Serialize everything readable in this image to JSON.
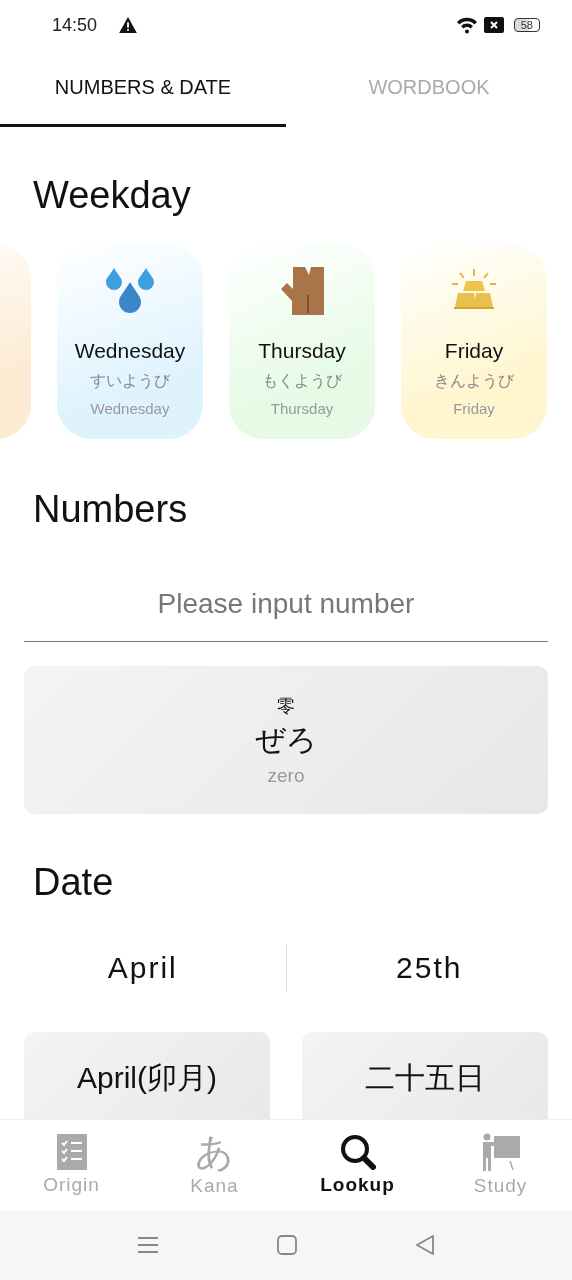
{
  "status_bar": {
    "time": "14:50",
    "battery": "58"
  },
  "tabs": [
    {
      "label": "NUMBERS & DATE",
      "selected": true
    },
    {
      "label": "WORDBOOK",
      "selected": false
    }
  ],
  "weekday": {
    "title": "Weekday",
    "days": [
      {
        "color": "#fdebd3"
      },
      {
        "kind": "water",
        "name": "Wednesday",
        "kana": "すいようび",
        "english": "Wednesday",
        "color": "#dff3ff"
      },
      {
        "kind": "wood",
        "name": "Thursday",
        "kana": "もくようび",
        "english": "Thursday",
        "color": "#e6fbe6"
      },
      {
        "kind": "gold",
        "name": "Friday",
        "kana": "きんようび",
        "english": "Friday",
        "color": "#fff6cf"
      }
    ]
  },
  "numbers": {
    "title": "Numbers",
    "placeholder": "Please input number",
    "result": {
      "kanji": "零",
      "kana": "ぜろ",
      "meaning": "zero"
    }
  },
  "date": {
    "title": "Date",
    "month": "April",
    "day": "25th",
    "cards": [
      "April(卯月)",
      "二十五日"
    ]
  },
  "bottom_nav": [
    {
      "kind": "list",
      "label": "Origin",
      "selected": false
    },
    {
      "kind": "kana",
      "glyph": "あ",
      "label": "Kana",
      "selected": false
    },
    {
      "kind": "search",
      "label": "Lookup",
      "selected": true
    },
    {
      "kind": "teacher",
      "label": "Study",
      "selected": false
    }
  ]
}
